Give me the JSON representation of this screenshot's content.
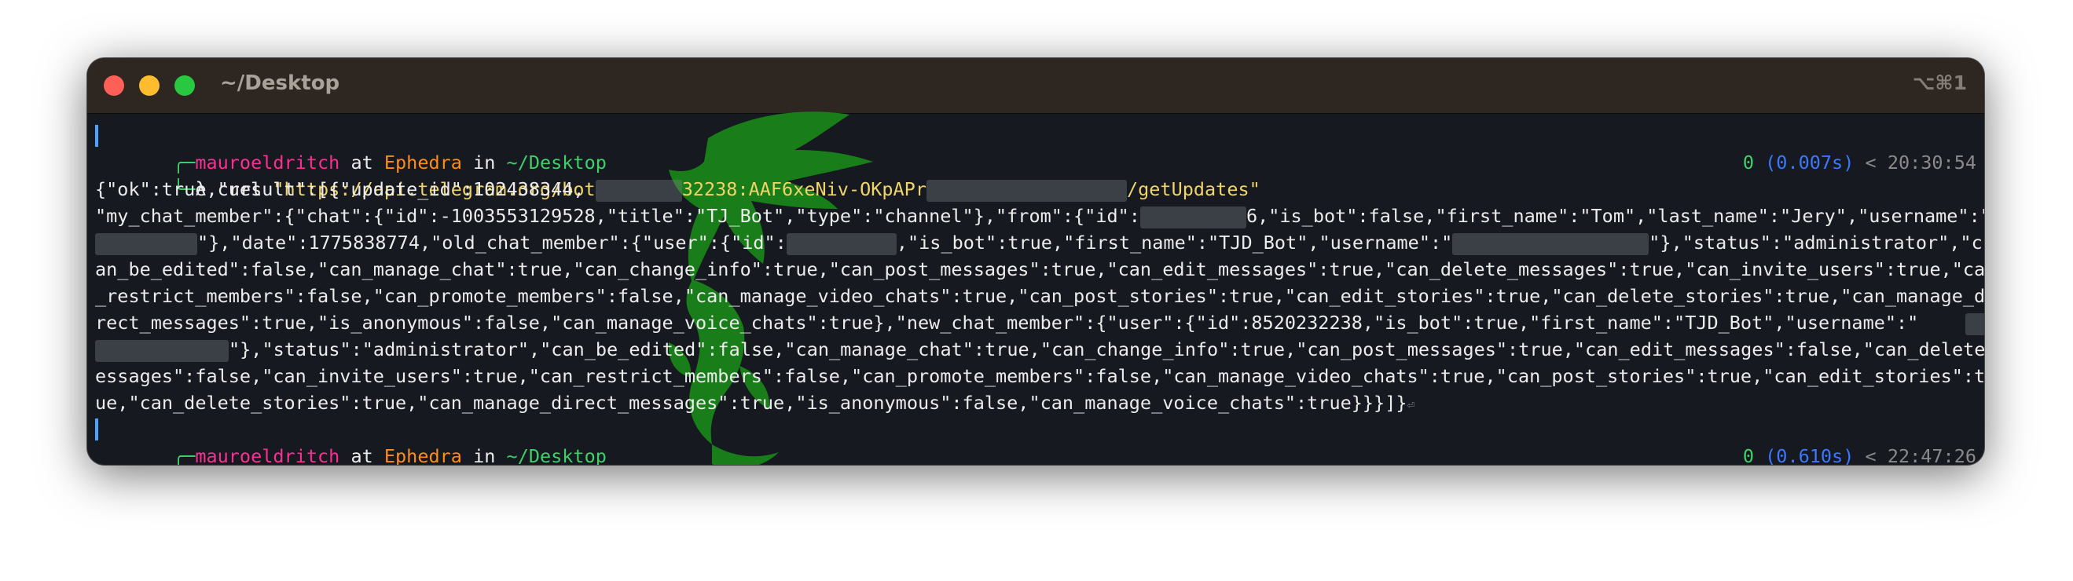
{
  "window": {
    "title": "~/Desktop",
    "shortcut": "⌥⌘1",
    "traffic_lights": {
      "close": "#fe5f57",
      "minimize": "#febc2e",
      "zoom": "#28c840"
    }
  },
  "prompt1": {
    "user": "mauroeldritch",
    "at": "at",
    "host": "Ephedra",
    "in": "in",
    "path": "~/Desktop"
  },
  "command1": {
    "symbol": "λ",
    "cmd": "curl",
    "url_start": "\"https://api.telegram.org/bot",
    "url_mid": "32238:AAF6xeNiv-OKpAPr",
    "url_end": "/getUpdates\"",
    "status": {
      "code": "0",
      "duration": "(0.007s)",
      "sep": "<",
      "time": "20:30:54"
    }
  },
  "output": {
    "l1": "{\"ok\":true,\"result\":[{\"update_id\":102438344,",
    "l2a": "\"my_chat_member\":{\"chat\":{\"id\":-1003553129528,\"title\":\"TJ_Bot\",\"type\":\"channel\"},\"from\":{\"id\":",
    "l2b": "6,\"is_bot\":false,\"first_name\":\"Tom\",\"last_name\":\"Jery\",\"username\":\"T",
    "l3a": "\"},\"date\":1775838774,\"old_chat_member\":{\"user\":{\"id\":",
    "l3b": ",\"is_bot\":true,\"first_name\":\"TJD_Bot\",\"username\":\"",
    "l3c": "\"},\"status\":\"administrator\",\"c",
    "l4": "an_be_edited\":false,\"can_manage_chat\":true,\"can_change_info\":true,\"can_post_messages\":true,\"can_edit_messages\":true,\"can_delete_messages\":true,\"can_invite_users\":true,\"can",
    "l5": "_restrict_members\":false,\"can_promote_members\":false,\"can_manage_video_chats\":true,\"can_post_stories\":true,\"can_edit_stories\":true,\"can_delete_stories\":true,\"can_manage_di",
    "l6": "rect_messages\":true,\"is_anonymous\":false,\"can_manage_voice_chats\":true},\"new_chat_member\":{\"user\":{\"id\":8520232238,\"is_bot\":true,\"first_name\":\"TJD_Bot\",\"username\":\"",
    "l7": "\"},\"status\":\"administrator\",\"can_be_edited\":false,\"can_manage_chat\":true,\"can_change_info\":true,\"can_post_messages\":true,\"can_edit_messages\":false,\"can_delete_m",
    "l8": "essages\":false,\"can_invite_users\":true,\"can_restrict_members\":false,\"can_promote_members\":false,\"can_manage_video_chats\":true,\"can_post_stories\":true,\"can_edit_stories\":tr",
    "l9": "ue,\"can_delete_stories\":true,\"can_manage_direct_messages\":true,\"is_anonymous\":false,\"can_manage_voice_chats\":true}}}]}",
    "l9_eol": "⏎"
  },
  "prompt2": {
    "user": "mauroeldritch",
    "at": "at",
    "host": "Ephedra",
    "in": "in",
    "path": "~/Desktop"
  },
  "command2": {
    "symbol": "λ",
    "status": {
      "code": "0",
      "duration": "(0.610s)",
      "sep": "<",
      "time": "22:47:26"
    }
  },
  "background_image": {
    "icon": "green-dragon-mascot",
    "color": "#1a8a1a"
  },
  "colors": {
    "background": "#16191f",
    "titlebar": "#2d2621",
    "user": "#ff2d92",
    "host": "#ff8c17",
    "path": "#3fd06a",
    "string": "#f0d468",
    "duration": "#3b78ff",
    "text": "#ececec"
  }
}
